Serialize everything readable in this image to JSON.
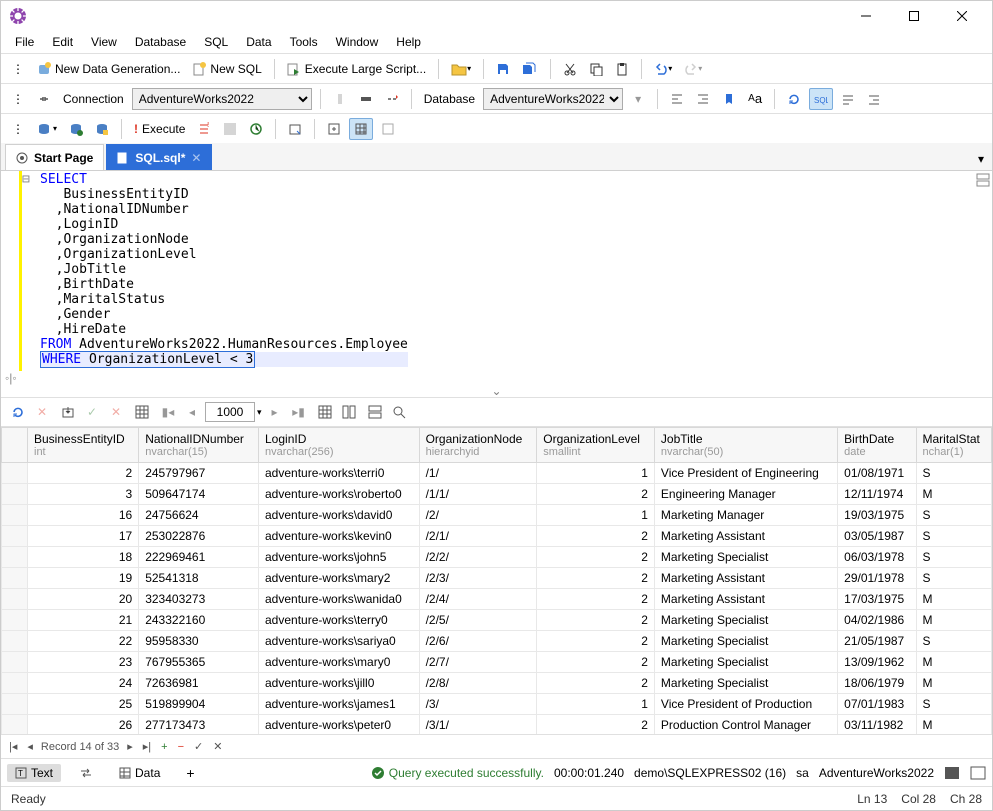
{
  "menu": [
    "File",
    "Edit",
    "View",
    "Database",
    "SQL",
    "Data",
    "Tools",
    "Window",
    "Help"
  ],
  "toolbar1": {
    "new_data_gen": "New Data Generation...",
    "new_sql": "New SQL",
    "exec_large": "Execute Large Script..."
  },
  "toolbar2": {
    "connection_label": "Connection",
    "connection_value": "AdventureWorks2022",
    "database_label": "Database",
    "database_value": "AdventureWorks2022"
  },
  "toolbar3": {
    "execute_label": "Execute"
  },
  "tabs": {
    "start_page": "Start Page",
    "sql_file": "SQL.sql*"
  },
  "sql": {
    "l1": "SELECT",
    "l2": "   BusinessEntityID",
    "l3": "  ,NationalIDNumber",
    "l4": "  ,LoginID",
    "l5": "  ,OrganizationNode",
    "l6": "  ,OrganizationLevel",
    "l7": "  ,JobTitle",
    "l8": "  ,BirthDate",
    "l9": "  ,MaritalStatus",
    "l10": "  ,Gender",
    "l11": "  ,HireDate",
    "l12a": "FROM",
    "l12b": " AdventureWorks2022.HumanResources.Employee",
    "l13a": "WHERE",
    "l13b": " OrganizationLevel < 3"
  },
  "results_nav": {
    "page_size": "1000"
  },
  "columns": [
    {
      "name": "BusinessEntityID",
      "type": "int"
    },
    {
      "name": "NationalIDNumber",
      "type": "nvarchar(15)"
    },
    {
      "name": "LoginID",
      "type": "nvarchar(256)"
    },
    {
      "name": "OrganizationNode",
      "type": "hierarchyid"
    },
    {
      "name": "OrganizationLevel",
      "type": "smallint"
    },
    {
      "name": "JobTitle",
      "type": "nvarchar(50)"
    },
    {
      "name": "BirthDate",
      "type": "date"
    },
    {
      "name": "MaritalStat",
      "type": "nchar(1)"
    }
  ],
  "rows": [
    [
      "2",
      "245797967",
      "adventure-works\\terri0",
      "/1/",
      "1",
      "Vice President of Engineering",
      "01/08/1971",
      "S"
    ],
    [
      "3",
      "509647174",
      "adventure-works\\roberto0",
      "/1/1/",
      "2",
      "Engineering Manager",
      "12/11/1974",
      "M"
    ],
    [
      "16",
      "24756624",
      "adventure-works\\david0",
      "/2/",
      "1",
      "Marketing Manager",
      "19/03/1975",
      "S"
    ],
    [
      "17",
      "253022876",
      "adventure-works\\kevin0",
      "/2/1/",
      "2",
      "Marketing Assistant",
      "03/05/1987",
      "S"
    ],
    [
      "18",
      "222969461",
      "adventure-works\\john5",
      "/2/2/",
      "2",
      "Marketing Specialist",
      "06/03/1978",
      "S"
    ],
    [
      "19",
      "52541318",
      "adventure-works\\mary2",
      "/2/3/",
      "2",
      "Marketing Assistant",
      "29/01/1978",
      "S"
    ],
    [
      "20",
      "323403273",
      "adventure-works\\wanida0",
      "/2/4/",
      "2",
      "Marketing Assistant",
      "17/03/1975",
      "M"
    ],
    [
      "21",
      "243322160",
      "adventure-works\\terry0",
      "/2/5/",
      "2",
      "Marketing Specialist",
      "04/02/1986",
      "M"
    ],
    [
      "22",
      "95958330",
      "adventure-works\\sariya0",
      "/2/6/",
      "2",
      "Marketing Specialist",
      "21/05/1987",
      "S"
    ],
    [
      "23",
      "767955365",
      "adventure-works\\mary0",
      "/2/7/",
      "2",
      "Marketing Specialist",
      "13/09/1962",
      "M"
    ],
    [
      "24",
      "72636981",
      "adventure-works\\jill0",
      "/2/8/",
      "2",
      "Marketing Specialist",
      "18/06/1979",
      "M"
    ],
    [
      "25",
      "519899904",
      "adventure-works\\james1",
      "/3/",
      "1",
      "Vice President of Production",
      "07/01/1983",
      "S"
    ],
    [
      "26",
      "277173473",
      "adventure-works\\peter0",
      "/3/1/",
      "2",
      "Production Control Manager",
      "03/11/1982",
      "M"
    ]
  ],
  "record_nav": {
    "text": "Record 14 of 33"
  },
  "bottom": {
    "text_tab": "Text",
    "data_tab": "Data",
    "status": "Query executed successfully.",
    "elapsed": "00:00:01.240",
    "server": "demo\\SQLEXPRESS02 (16)",
    "user": "sa",
    "db": "AdventureWorks2022"
  },
  "status": {
    "ready": "Ready",
    "ln": "Ln 13",
    "col": "Col 28",
    "ch": "Ch 28"
  }
}
